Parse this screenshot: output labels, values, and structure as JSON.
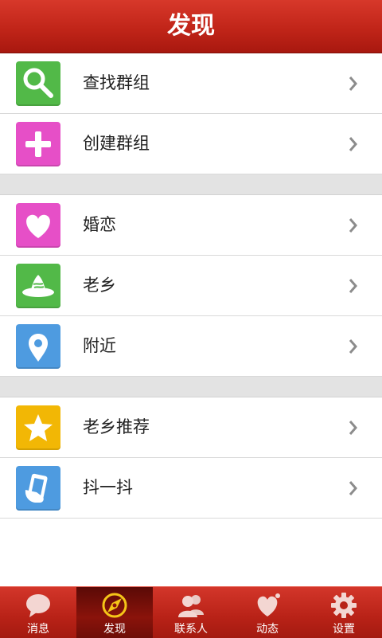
{
  "header": {
    "title": "发现"
  },
  "rows": [
    {
      "label": "查找群组",
      "icon": "search-icon",
      "color": "#52b948"
    },
    {
      "label": "创建群组",
      "icon": "plus-icon",
      "color": "#e64fc7"
    },
    {
      "label": "婚恋",
      "icon": "heart-icon",
      "color": "#e64fc7"
    },
    {
      "label": "老乡",
      "icon": "hometown-icon",
      "color": "#52b948"
    },
    {
      "label": "附近",
      "icon": "location-pin-icon",
      "color": "#4e9be0"
    },
    {
      "label": "老乡推荐",
      "icon": "star-icon",
      "color": "#f2b705"
    },
    {
      "label": "抖一抖",
      "icon": "shake-phone-icon",
      "color": "#4e9be0"
    }
  ],
  "tabs": [
    {
      "label": "消息",
      "icon": "chat-bubble-icon",
      "active": false
    },
    {
      "label": "发现",
      "icon": "compass-icon",
      "active": true
    },
    {
      "label": "联系人",
      "icon": "contacts-icon",
      "active": false
    },
    {
      "label": "动态",
      "icon": "heart-icon",
      "active": false
    },
    {
      "label": "设置",
      "icon": "gear-icon",
      "active": false
    }
  ],
  "colors": {
    "header": "#c12519",
    "tabbar": "#b82217",
    "active_tab": "#6e0e08"
  }
}
